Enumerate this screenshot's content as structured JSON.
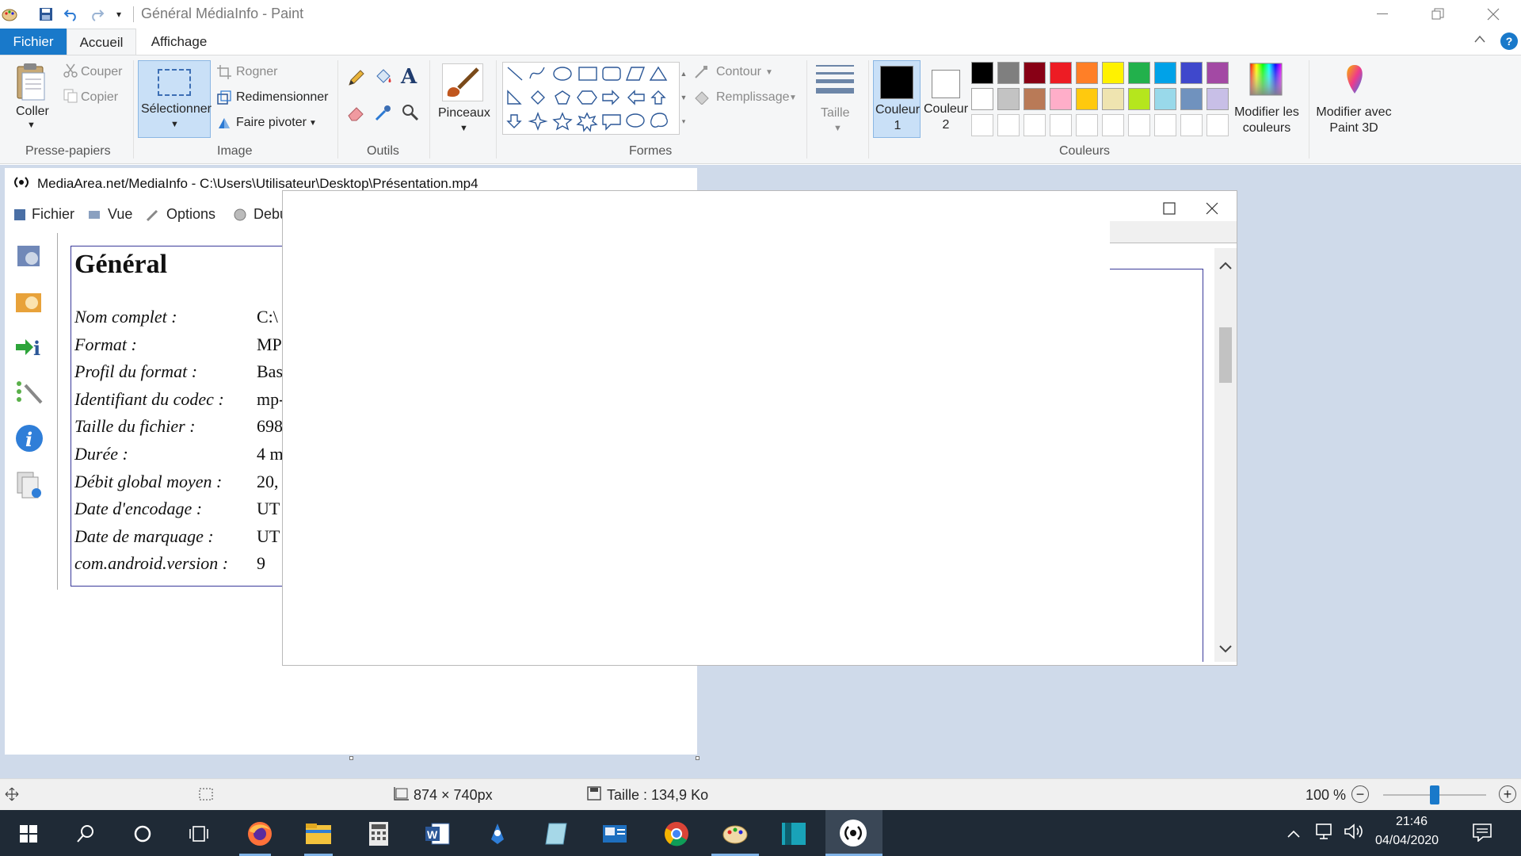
{
  "window": {
    "title": "Général MédiaInfo - Paint"
  },
  "tabs": [
    {
      "label": "Fichier"
    },
    {
      "label": "Accueil"
    },
    {
      "label": "Affichage"
    }
  ],
  "ribbon": {
    "clipboard": {
      "paste": "Coller",
      "cut": "Couper",
      "copy": "Copier",
      "group": "Presse-papiers"
    },
    "image": {
      "select": "Sélectionner",
      "crop": "Rogner",
      "resize": "Redimensionner",
      "rotate": "Faire pivoter",
      "group": "Image"
    },
    "tools": {
      "group": "Outils"
    },
    "brushes": {
      "label": "Pinceaux"
    },
    "shapes": {
      "outline": "Contour",
      "fill": "Remplissage",
      "group": "Formes"
    },
    "size": {
      "label": "Taille"
    },
    "colors": {
      "color1": "Couleur 1",
      "color2": "Couleur 2",
      "edit": "Modifier les couleurs",
      "paint3d": "Modifier avec Paint 3D",
      "group": "Couleurs",
      "palette_row1": [
        "#000000",
        "#7f7f7f",
        "#880015",
        "#ed1c24",
        "#ff7f27",
        "#fff200",
        "#22b14c",
        "#00a2e8",
        "#3f48cc",
        "#a349a4"
      ],
      "palette_row2": [
        "#ffffff",
        "#c3c3c3",
        "#b97a57",
        "#ffaec9",
        "#ffc90e",
        "#efe4b0",
        "#b5e61d",
        "#99d9ea",
        "#7092be",
        "#c8bfe7"
      ]
    }
  },
  "canvas": {
    "mediainfo": {
      "title": "MediaArea.net/MediaInfo - C:\\Users\\Utilisateur\\Desktop\\Présentation.mp4",
      "menu": [
        "Fichier",
        "Vue",
        "Options",
        "Debu"
      ],
      "heading": "Général",
      "rows": [
        {
          "label": "Nom complet :",
          "value": "C:\\"
        },
        {
          "label": "Format :",
          "value": "MP"
        },
        {
          "label": "Profil du format :",
          "value": "Bas"
        },
        {
          "label": "Identifiant du codec :",
          "value": "mp-"
        },
        {
          "label": "Taille du fichier :",
          "value": "698"
        },
        {
          "label": "Durée :",
          "value": "4 m"
        },
        {
          "label": "Débit global moyen :",
          "value": "20,"
        },
        {
          "label": "Date d'encodage :",
          "value": "UT"
        },
        {
          "label": "Date de marquage :",
          "value": "UT"
        },
        {
          "label": "com.android.version :",
          "value": "9"
        }
      ]
    }
  },
  "status": {
    "dimensions": "874 × 740px",
    "size": "Taille : 134,9 Ko",
    "zoom": "100 %",
    "zoom_level": 0.5
  },
  "taskbar": {
    "time": "21:46",
    "date": "04/04/2020"
  }
}
